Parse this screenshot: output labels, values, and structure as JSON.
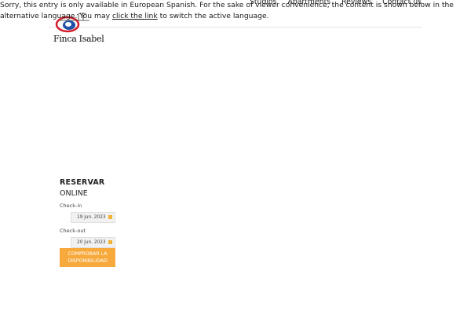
{
  "notice": {
    "text_before_link": "Sorry, this entry is only available in European Spanish. For the sake of viewer convenience, the content is shown below in the alternative language. You may ",
    "link_text": "click the link",
    "text_after_link": " to switch the active language."
  },
  "nav": {
    "items": [
      "Studios",
      "Apartments",
      "Reviews",
      "Contact us"
    ]
  },
  "logo": {
    "text": "Finca Isabel"
  },
  "booking": {
    "title": "RESERVAR",
    "subtitle": "ONLINE",
    "checkin_label": "Check-in",
    "checkin_value": "19 jun. 2023",
    "checkout_label": "Check-out",
    "checkout_value": "20 jun. 2023",
    "button_label": "COMPROBAR LA DISPONIBILIDAD",
    "accent_color": "#f7a93b"
  }
}
